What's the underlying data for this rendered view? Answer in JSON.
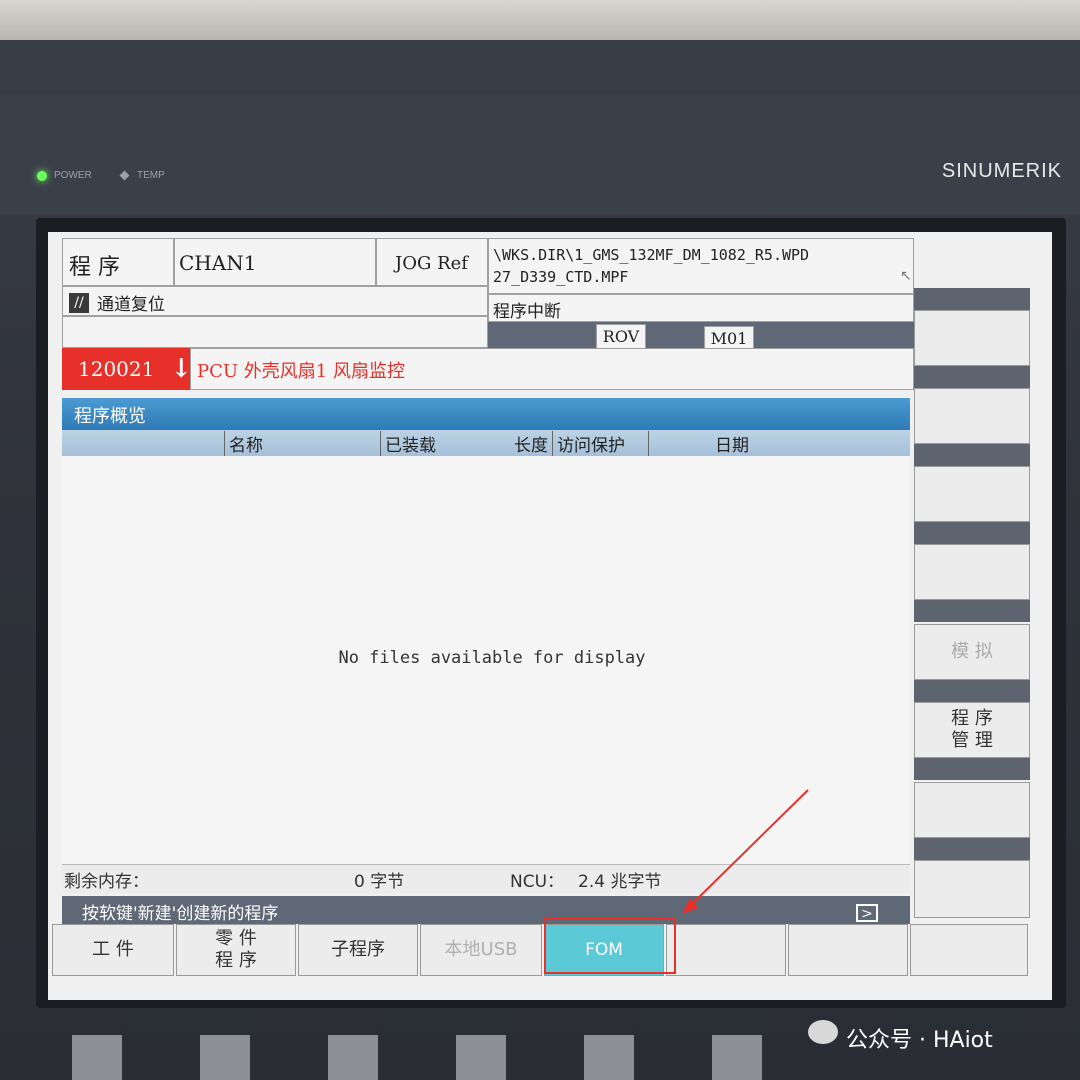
{
  "device": {
    "brand": "SINUMERIK",
    "power_label": "POWER",
    "temp_label": "TEMP"
  },
  "header": {
    "area": "程 序",
    "channel": "CHAN1",
    "mode": "JOG Ref",
    "program_path_line1": "\\WKS.DIR\\1_GMS_132MF_DM_1082_R5.WPD",
    "program_path_line2": "27_D339_CTD.MPF",
    "channel_status": "通道复位",
    "program_status": "程序中断",
    "rov": "ROV",
    "m01": "M01"
  },
  "alarm": {
    "number": "120021",
    "text": "PCU 外壳风扇1 风扇监控",
    "color": "#e8302a"
  },
  "overview": {
    "title": "程序概览",
    "columns": [
      "名称",
      "已装载",
      "长度",
      "访问保护",
      "日期"
    ],
    "empty_message": "No files available for display"
  },
  "memory": {
    "label": "剩余内存：",
    "local_value": "0 字节",
    "ncu_label": "NCU：",
    "ncu_value": "2.4 兆字节"
  },
  "hint": "按软键'新建'创建新的程序",
  "horizontal_softkeys": [
    {
      "label": "工 件"
    },
    {
      "label": "零 件\n程 序"
    },
    {
      "label": "子程序"
    },
    {
      "label": "本地USB"
    },
    {
      "label": "FOM"
    },
    {
      "label": ""
    },
    {
      "label": ""
    },
    {
      "label": ""
    }
  ],
  "vertical_softkeys": [
    {
      "label": ""
    },
    {
      "label": ""
    },
    {
      "label": ""
    },
    {
      "label": ""
    },
    {
      "label": "模 拟"
    },
    {
      "label": "程 序\n管 理"
    },
    {
      "label": ""
    },
    {
      "label": ""
    }
  ],
  "accent": {
    "header_blue": "#3c8bc4",
    "fom_cyan": "#5bc9d6",
    "annotation_red": "#e8302a"
  },
  "watermark": "公众号 · HAiot"
}
